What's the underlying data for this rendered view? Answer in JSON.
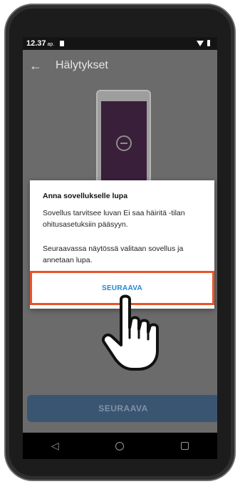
{
  "status": {
    "time": "12.37",
    "ampm": "ap."
  },
  "appbar": {
    "title": "Hälytykset"
  },
  "dialog": {
    "title": "Anna sovellukselle lupa",
    "text1": "Sovellus tarvitsee luvan Ei saa häiritä -tilan ohitusasetuksiin pääsyyn.",
    "text2": "Seuraavassa näytössä valitaan sovellus ja annetaan lupa.",
    "button": "SEURAAVA"
  },
  "bottom_button": {
    "label": "SEURAAVA"
  },
  "nav": {
    "back": "◁"
  },
  "colors": {
    "highlight": "#e8542b",
    "accent": "#1e88d6",
    "primary_dim": "#3a5571"
  },
  "icons": [
    "arrow-back-icon",
    "wifi-icon",
    "battery-icon",
    "sim-icon",
    "do-not-disturb-icon",
    "pointing-hand-icon",
    "nav-back-icon",
    "nav-home-icon",
    "nav-recent-icon"
  ]
}
